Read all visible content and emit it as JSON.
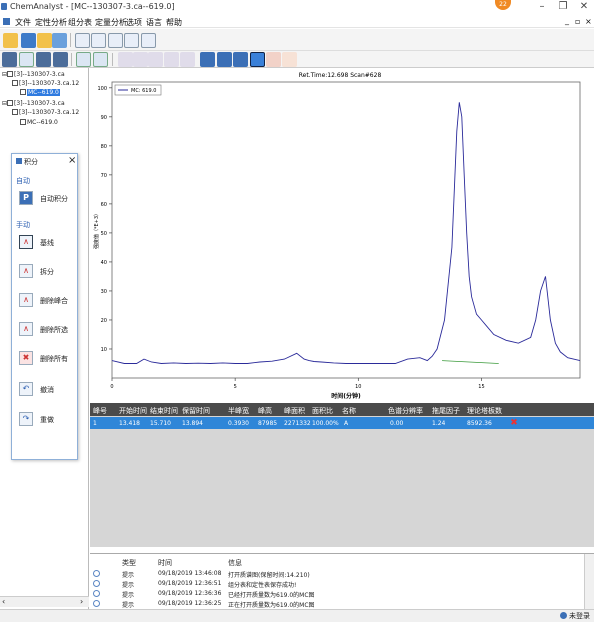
{
  "window": {
    "title": "ChemAnalyst - [MC--130307-3.ca--619.0]",
    "badge": "22"
  },
  "menu": [
    "文件",
    "定性分析",
    "组分表",
    "定量分析",
    "选项",
    "语言",
    "帮助"
  ],
  "tree": {
    "items": [
      "[3]--130307-3.ca",
      "[3]--130307-3.ca.12",
      "MC--619.0",
      "[3]--130307-3.ca",
      "[3]--130307-3.ca.12",
      "MC--619.0"
    ]
  },
  "integration": {
    "title": "积分",
    "auto_heading": "自动",
    "auto_label": "自动积分",
    "manual_heading": "手动",
    "tools": [
      "基线",
      "拆分",
      "删除峰合",
      "删除所选",
      "删除所有",
      "撤消",
      "重做"
    ]
  },
  "chart_data": {
    "type": "line",
    "header": "Ret.Time:12.698 Scan#628",
    "legend": "MC: 619.0",
    "ylabel": "强度值（*E+3）",
    "xlabel": "时间(分钟)",
    "xlim": [
      0,
      19
    ],
    "ylim": [
      0,
      102
    ],
    "xticks": [
      0,
      5,
      10,
      15
    ],
    "yticks": [
      10,
      20,
      30,
      40,
      50,
      60,
      70,
      80,
      90,
      100
    ],
    "x": [
      0,
      0.5,
      1,
      1.3,
      1.6,
      2,
      2.5,
      3,
      3.5,
      4,
      4.5,
      5,
      5.5,
      6,
      6.5,
      7,
      7.5,
      7.8,
      8,
      8.2,
      8.5,
      9,
      9.5,
      10,
      10.5,
      11,
      11.5,
      12,
      12.5,
      12.8,
      13,
      13.2,
      13.5,
      13.8,
      14,
      14.1,
      14.2,
      14.3,
      14.4,
      14.5,
      14.6,
      14.8,
      15,
      15.2,
      15.5,
      16,
      16.5,
      17,
      17.2,
      17.4,
      17.6,
      17.8,
      18,
      18.2,
      18.5,
      19
    ],
    "y": [
      6,
      5,
      5,
      6.5,
      5.5,
      5,
      5.2,
      5,
      5.1,
      5,
      5.2,
      5,
      5,
      5.5,
      5.8,
      6.5,
      8.5,
      6.5,
      6,
      5.7,
      5.5,
      5.2,
      5,
      5,
      5,
      5,
      5,
      6.5,
      7,
      6,
      7.5,
      10,
      20,
      45,
      85,
      95,
      90,
      70,
      50,
      35,
      28,
      22,
      20,
      18,
      15,
      13,
      12,
      14,
      20,
      30,
      35,
      20,
      12,
      9,
      7,
      6
    ],
    "series_color": "#2b2b9a"
  },
  "table": {
    "headers": [
      "峰号",
      "开始时间",
      "结束时间",
      "保留时间",
      "半峰宽",
      "峰高",
      "峰面积",
      "面积比",
      "名称",
      "色谱分辨率",
      "拖尾因子",
      "理论塔板数"
    ],
    "row": [
      "1",
      "13.418",
      "15.710",
      "13.894",
      "0.3930",
      "87985",
      "2271332",
      "100.00%",
      "A",
      "0.00",
      "1.24",
      "8592.36"
    ]
  },
  "log": {
    "headers": [
      "类型",
      "时间",
      "信息"
    ],
    "rows": [
      [
        "提示",
        "09/18/2019 13:46:08",
        "打开质谱图(保留时间:14.210)"
      ],
      [
        "提示",
        "09/18/2019 12:36:51",
        "组分表和定性表保存成功!"
      ],
      [
        "提示",
        "09/18/2019 12:36:36",
        "已经打开质量数为619.0的MC图"
      ],
      [
        "提示",
        "09/18/2019 12:36:25",
        "正在打开质量数为619.0的MC图"
      ]
    ]
  },
  "status": {
    "login": "未登录"
  }
}
